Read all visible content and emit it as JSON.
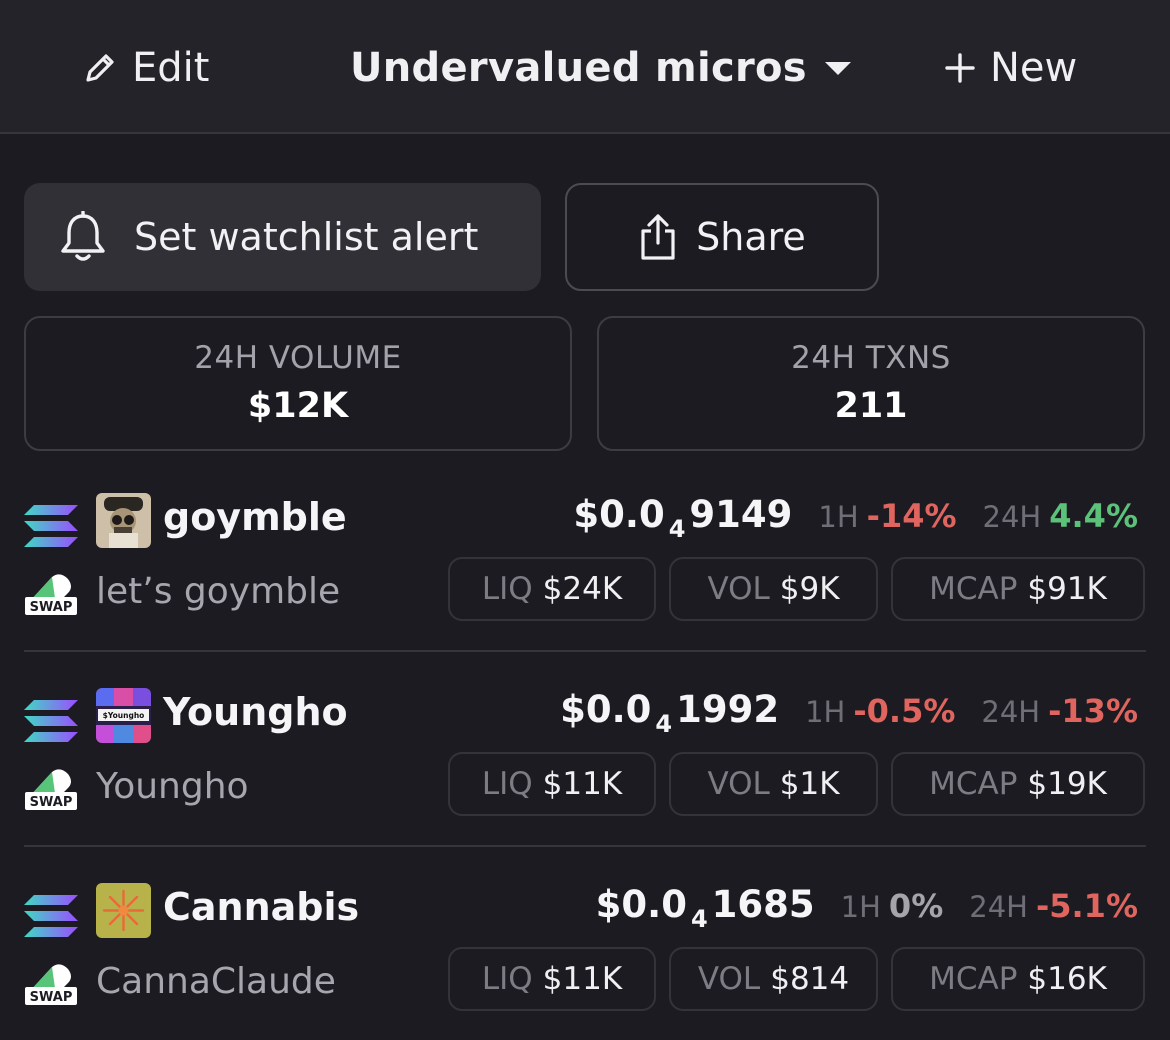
{
  "header": {
    "edit_label": "Edit",
    "watchlist_title": "Undervalued micros",
    "new_label": "New"
  },
  "actions": {
    "alert_label": "Set watchlist alert",
    "share_label": "Share"
  },
  "stats": {
    "volume_label": "24H VOLUME",
    "volume_value": "$12K",
    "txns_label": "24H TXNS",
    "txns_value": "211"
  },
  "tokens": [
    {
      "symbol": "goymble",
      "name": "let’s goymble",
      "price_prefix": "$0.0",
      "price_zeros": "4",
      "price_digits": "9149",
      "h1_label": "1H",
      "h1_change": "-14%",
      "h24_label": "24H",
      "h24_change": "4.4%",
      "liq_label": "LIQ",
      "liq_value": "$24K",
      "vol_label": "VOL",
      "vol_value": "$9K",
      "mcap_label": "MCAP",
      "mcap_value": "$91K",
      "swap_label": "SWAP"
    },
    {
      "symbol": "Youngho",
      "name": "Youngho",
      "avatar_text": "$Youngho",
      "price_prefix": "$0.0",
      "price_zeros": "4",
      "price_digits": "1992",
      "h1_label": "1H",
      "h1_change": "-0.5%",
      "h24_label": "24H",
      "h24_change": "-13%",
      "liq_label": "LIQ",
      "liq_value": "$11K",
      "vol_label": "VOL",
      "vol_value": "$1K",
      "mcap_label": "MCAP",
      "mcap_value": "$19K",
      "swap_label": "SWAP"
    },
    {
      "symbol": "Cannabis",
      "name": "CannaClaude",
      "price_prefix": "$0.0",
      "price_zeros": "4",
      "price_digits": "1685",
      "h1_label": "1H",
      "h1_change": "0%",
      "h24_label": "24H",
      "h24_change": "-5.1%",
      "liq_label": "LIQ",
      "liq_value": "$11K",
      "vol_label": "VOL",
      "vol_value": "$814",
      "mcap_label": "MCAP",
      "mcap_value": "$16K",
      "swap_label": "SWAP"
    }
  ],
  "colors": {
    "background": "#1c1b22",
    "negative": "#e0655f",
    "positive": "#5cc27a",
    "neutral": "#a5a4ab"
  },
  "icons": {
    "edit": "pencil-icon",
    "dropdown": "caret-down-icon",
    "new": "plus-icon",
    "alert": "bell-icon",
    "share": "share-icon",
    "chain": "solana-icon",
    "dex": "swap-icon"
  }
}
